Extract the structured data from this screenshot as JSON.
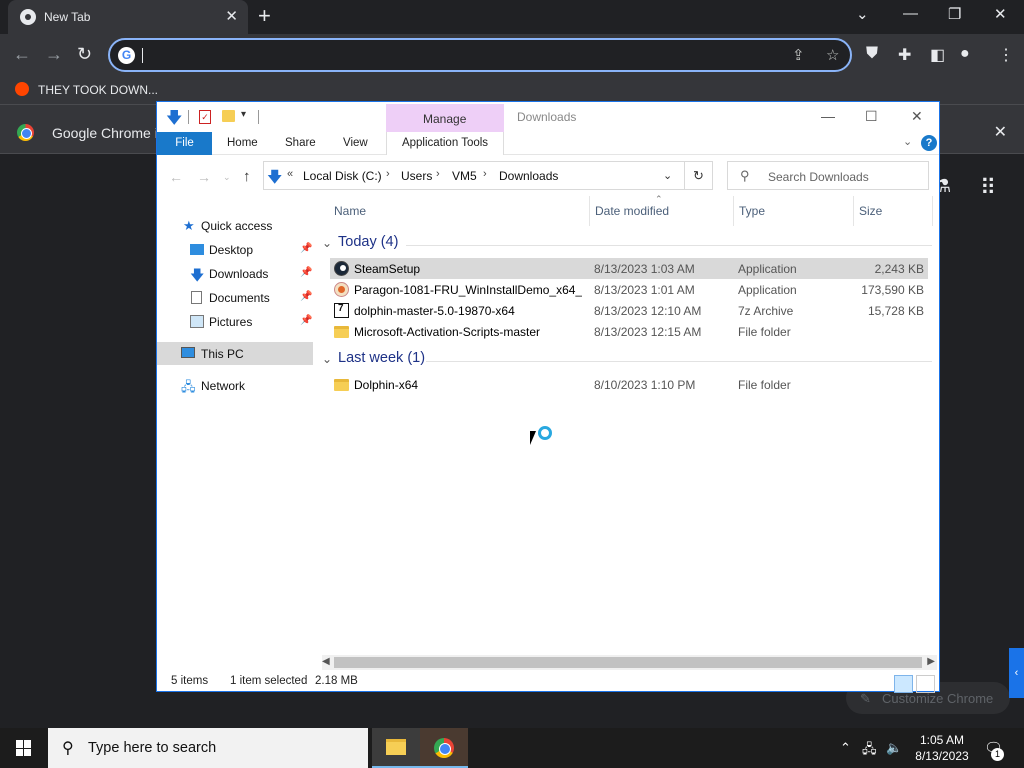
{
  "browser": {
    "tab_title": "New Tab",
    "omnibox_value": "",
    "bookmark_label": "THEY TOOK DOWN...",
    "infobar_message": "Google Chrome is",
    "customize_label": "Customize Chrome"
  },
  "explorer": {
    "window_title": "Downloads",
    "manage_label": "Manage",
    "ribbon": {
      "file": "File",
      "home": "Home",
      "share": "Share",
      "view": "View",
      "app_tools": "Application Tools"
    },
    "address": {
      "chevron": "«",
      "segments": [
        "Local Disk (C:)",
        "Users",
        "VM5",
        "Downloads"
      ]
    },
    "search_placeholder": "Search Downloads",
    "nav": [
      {
        "label": "Quick access",
        "pinned": false
      },
      {
        "label": "Desktop",
        "pinned": true
      },
      {
        "label": "Downloads",
        "pinned": true
      },
      {
        "label": "Documents",
        "pinned": true
      },
      {
        "label": "Pictures",
        "pinned": true
      },
      {
        "label": "This PC",
        "pinned": false,
        "selected": true
      },
      {
        "label": "Network",
        "pinned": false
      }
    ],
    "columns": [
      "Name",
      "Date modified",
      "Type",
      "Size"
    ],
    "groups": [
      {
        "label": "Today (4)",
        "files": [
          {
            "name": "SteamSetup",
            "date": "8/13/2023 1:03 AM",
            "type": "Application",
            "size": "2,243 KB",
            "icon": "steam-icon",
            "selected": true
          },
          {
            "name": "Paragon-1081-FRU_WinInstallDemo_x64_...",
            "date": "8/13/2023 1:01 AM",
            "type": "Application",
            "size": "173,590 KB",
            "icon": "paragon-icon"
          },
          {
            "name": "dolphin-master-5.0-19870-x64",
            "date": "8/13/2023 12:10 AM",
            "type": "7z Archive",
            "size": "15,728 KB",
            "icon": "7z-icon"
          },
          {
            "name": "Microsoft-Activation-Scripts-master",
            "date": "8/13/2023 12:15 AM",
            "type": "File folder",
            "size": "",
            "icon": "folder-icon"
          }
        ]
      },
      {
        "label": "Last week (1)",
        "files": [
          {
            "name": "Dolphin-x64",
            "date": "8/10/2023 1:10 PM",
            "type": "File folder",
            "size": "",
            "icon": "folder-icon"
          }
        ]
      }
    ],
    "status": {
      "items": "5 items",
      "selected": "1 item selected",
      "size": "2.18 MB"
    }
  },
  "taskbar": {
    "search_placeholder": "Type here to search",
    "time": "1:05 AM",
    "date": "8/13/2023",
    "notification_count": "1"
  }
}
